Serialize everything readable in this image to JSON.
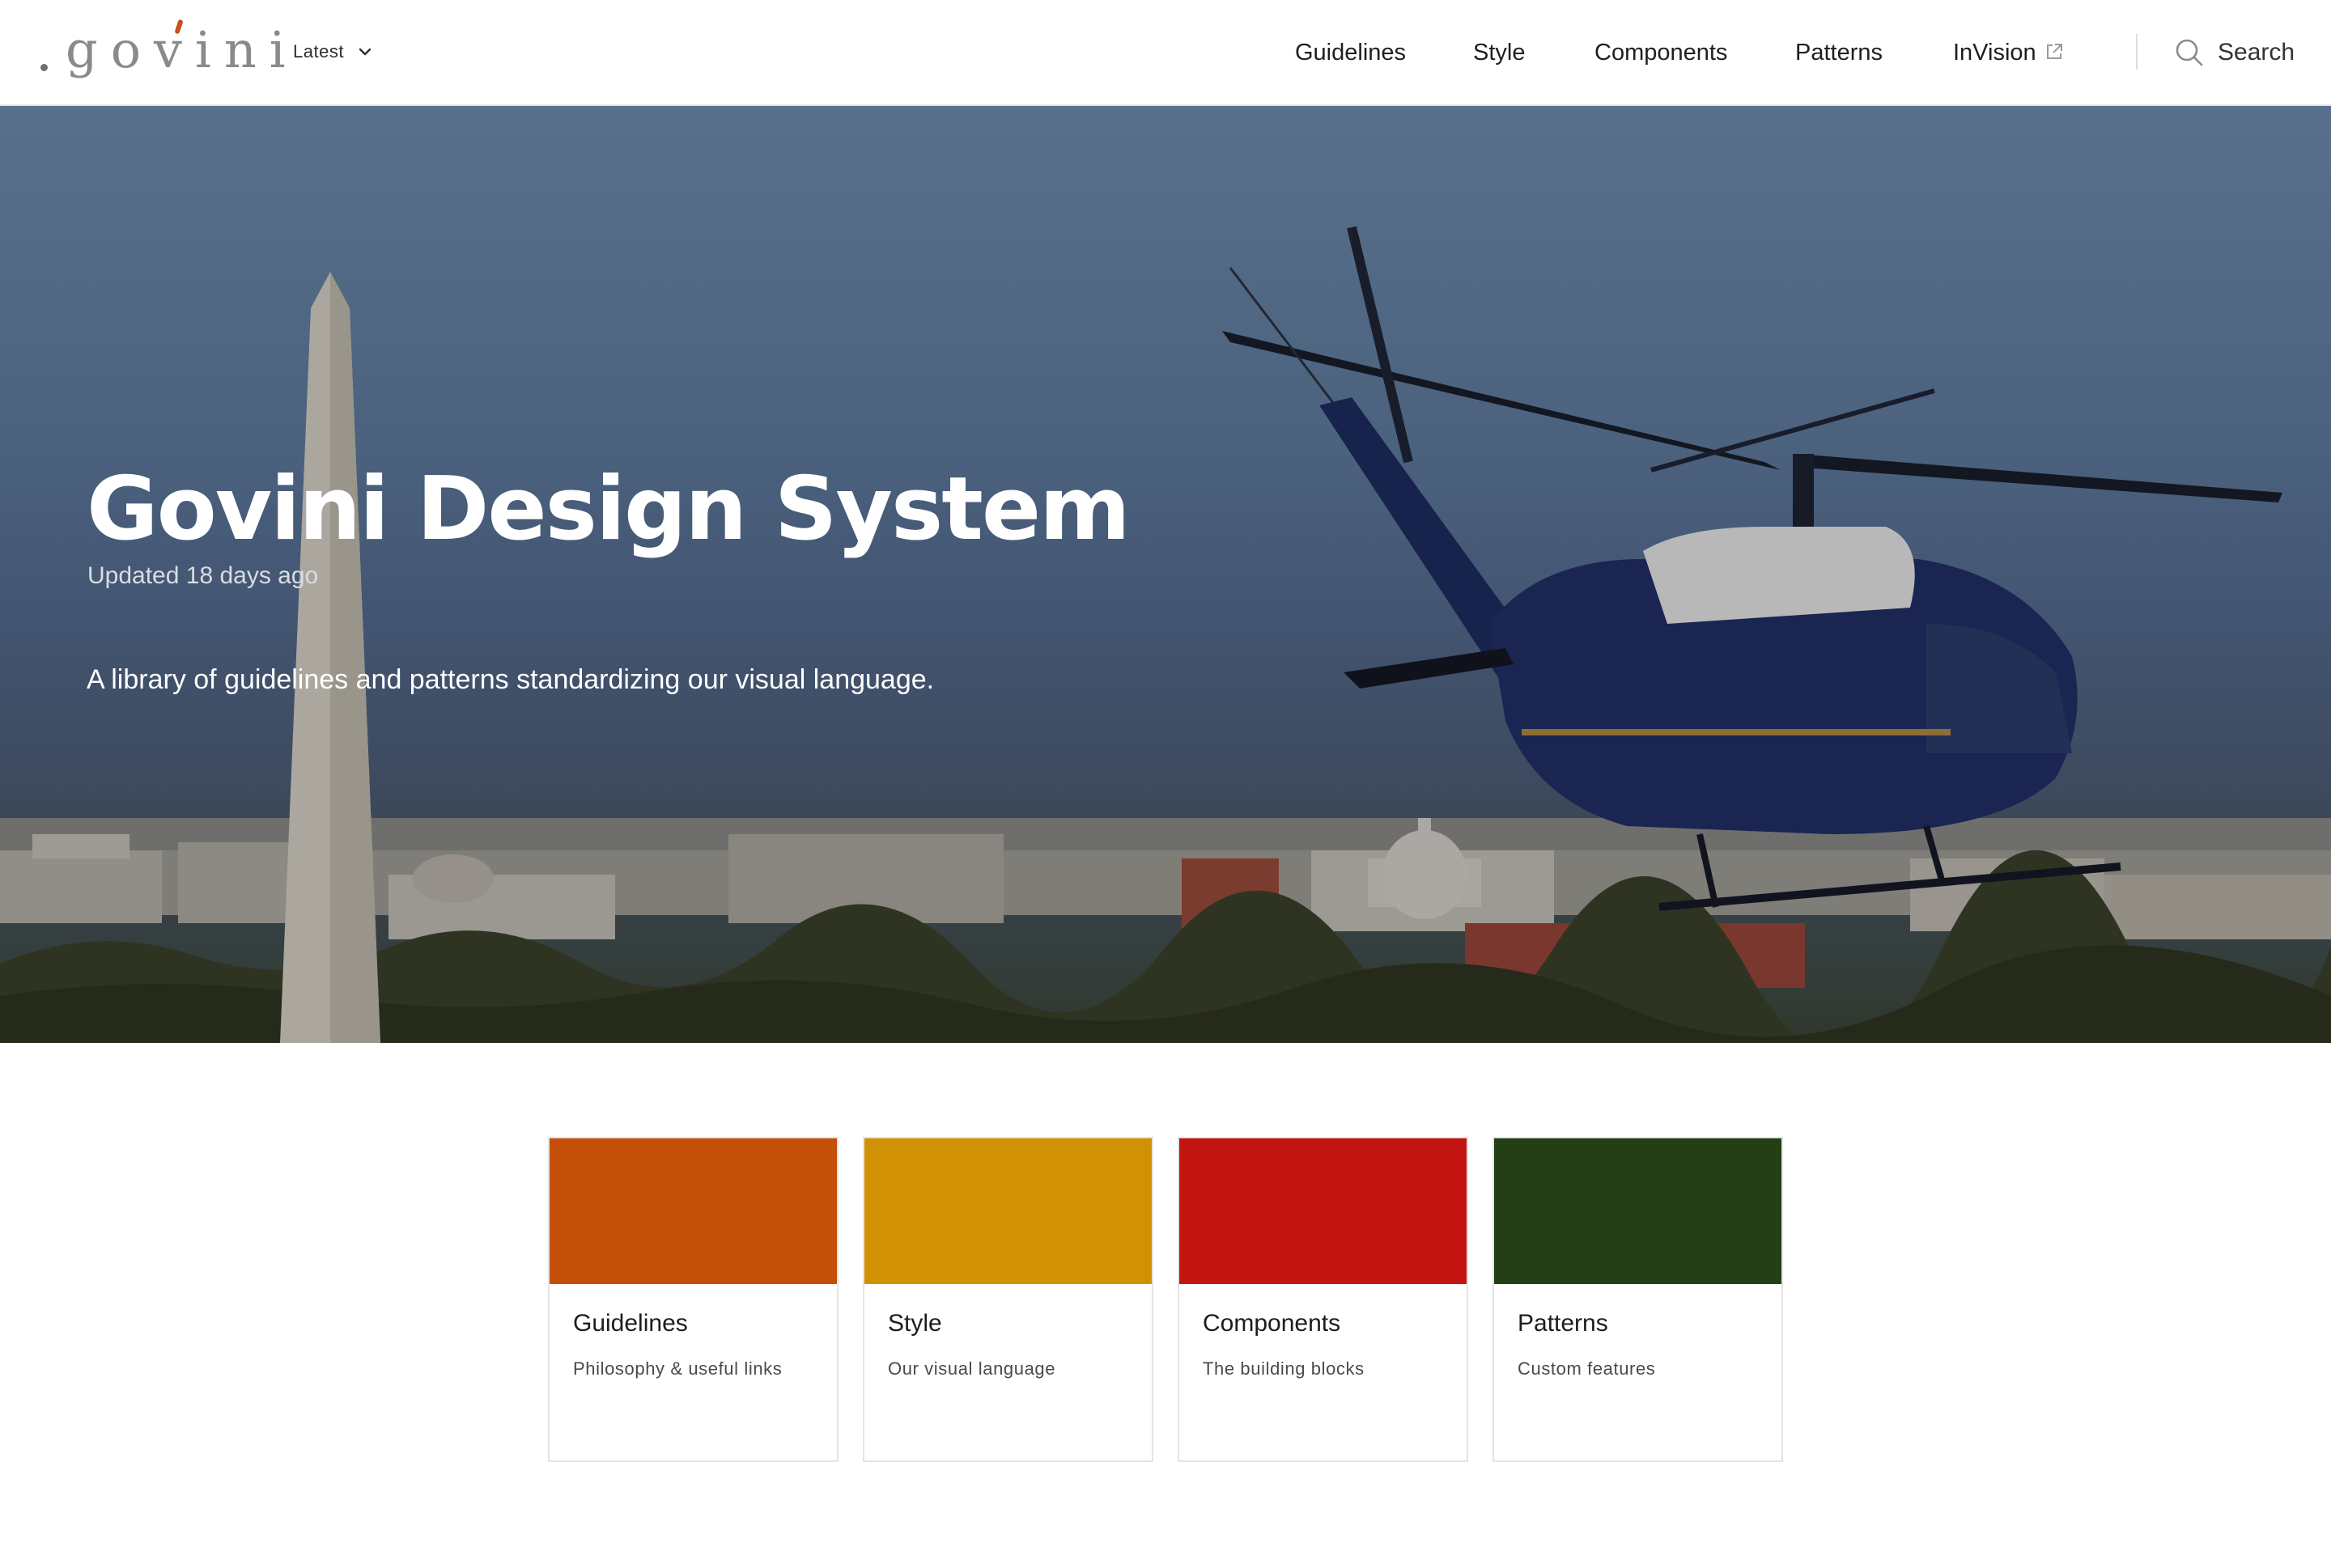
{
  "header": {
    "logo_text": "govini",
    "version": {
      "label": "Latest",
      "icon": "chevron-down-icon"
    },
    "nav": [
      {
        "label": "Guidelines"
      },
      {
        "label": "Style"
      },
      {
        "label": "Components"
      },
      {
        "label": "Patterns"
      },
      {
        "label": "InVision",
        "icon": "external-link-icon"
      }
    ],
    "search": {
      "label": "Search",
      "icon": "search-icon"
    }
  },
  "hero": {
    "title": "Govini Design System",
    "updated": "Updated 18 days ago",
    "description": "A library of guidelines and patterns standardizing our visual language.",
    "image": "Helicopter flying over Washington DC with the Washington Monument and Capitol"
  },
  "cards": [
    {
      "title": "Guidelines",
      "subtitle": "Philosophy & useful links",
      "color": "#c34f08"
    },
    {
      "title": "Style",
      "subtitle": "Our visual language",
      "color": "#d09104"
    },
    {
      "title": "Components",
      "subtitle": "The building blocks",
      "color": "#c21512"
    },
    {
      "title": "Patterns",
      "subtitle": "Custom features",
      "color": "#243f16"
    }
  ],
  "colors": {
    "header_border": "#e3e3e3",
    "text_primary": "#1f1f1f",
    "logo_accent": "#c8501a"
  }
}
